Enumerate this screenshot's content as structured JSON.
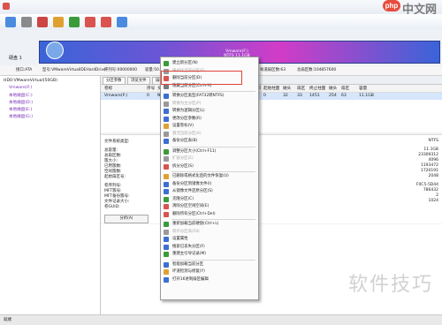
{
  "brand": {
    "logo": "php",
    "text": "中文网"
  },
  "disk": {
    "label": "硬盘 1",
    "partition_name": "Vmware(F:)",
    "partition_size": "NTFS 11.1GB"
  },
  "infobar": {
    "i1": "接口:ATA",
    "i2": "型号:VMwareVirtualIDEHardDrive",
    "i3": "序列号:00000000",
    "i4": "容量:50.0GB(51200MB)",
    "i5": "柱面数:6527",
    "i6": "磁头数:255",
    "i7": "每道扇区数:63",
    "i8": "总扇区数:104857600"
  },
  "tree": {
    "items": [
      {
        "label": "HD0:VMwareVirtual(50GB)",
        "color": "#222222"
      },
      {
        "label": "Vmware(F:)",
        "color": "#7a2fb5"
      },
      {
        "label": "本地磁盘(C:)",
        "color": "#7a2fb5"
      },
      {
        "label": "本地磁盘(D:)",
        "color": "#7a2fb5"
      },
      {
        "label": "本地磁盘(E:)",
        "color": "#7a2fb5"
      },
      {
        "label": "本地磁盘(G:)",
        "color": "#7a2fb5"
      }
    ]
  },
  "tabs": [
    "分区参数",
    "浏览文件",
    "扇区编辑"
  ],
  "filelist": {
    "headers": [
      "卷标",
      "序号",
      "文件系统",
      "标识",
      "起始柱面",
      "磁头",
      "扇区",
      "终止柱面",
      "磁头",
      "扇区",
      "容量"
    ],
    "row": {
      "name": "Vmware(F:)",
      "cells": [
        "0",
        "NTFS",
        "07",
        "0",
        "32",
        "33",
        "1451",
        "254",
        "63",
        "11.1GB"
      ]
    }
  },
  "details": {
    "section_title": "文件系统类型:",
    "labels": [
      "总容量:",
      "总扇区数:",
      "簇大小:",
      "已用簇数:",
      "空闲簇数:",
      "起始扇区号:",
      "卷序列号:",
      "MFT簇号:",
      "MFT备份簇号:",
      "文件记录大小:",
      "卷GUID:"
    ],
    "values": [
      "NTFS",
      "11.1GB",
      "23309312",
      "4096",
      "1193472",
      "1720191",
      "2048",
      "F0C5-5D44",
      "786432",
      "2",
      "1024"
    ],
    "button": "分析(A)"
  },
  "context_menu": {
    "items": [
      {
        "label": "建立新分区(N)",
        "disabled": false,
        "color": "#3a9b3a"
      },
      {
        "label": "格式化当前分区(F)",
        "disabled": true,
        "color": "#999999"
      },
      {
        "label": "删除当前分区(D)",
        "disabled": false,
        "color": "#d9534f"
      },
      {
        "label": "隐藏当前分区(Ctrl+H)",
        "disabled": false,
        "color": "#7a7a7a"
      },
      {
        "label": "转换分区类型(FAT32转NTFS)",
        "disabled": false,
        "color": "#3c6fd1"
      },
      {
        "label": "转换为主分区(P)",
        "disabled": true,
        "color": "#999999"
      },
      {
        "label": "转换为逻辑分区(L)",
        "disabled": false,
        "color": "#3c6fd1"
      },
      {
        "label": "更改分区参数(R)",
        "disabled": false,
        "color": "#3c6fd1"
      },
      {
        "label": "设置卷标(V)",
        "disabled": false,
        "color": "#e0a030"
      },
      {
        "label": "激活当前分区(A)",
        "disabled": true,
        "color": "#999999"
      },
      {
        "label": "备份分区表(B)",
        "disabled": false,
        "color": "#3c6fd1"
      },
      {
        "label": "调整分区大小(Ctrl+F11)",
        "disabled": false,
        "color": "#3a9b3a"
      },
      {
        "label": "扩容分区(E)",
        "disabled": true,
        "color": "#999999"
      },
      {
        "label": "拆分分区(S)",
        "disabled": false,
        "color": "#d9534f"
      },
      {
        "label": "已删除或格式化后的文件恢复(U)",
        "disabled": false,
        "color": "#e0a030"
      },
      {
        "label": "备份分区到镜像文件(I)",
        "disabled": false,
        "color": "#3c6fd1"
      },
      {
        "label": "从镜像文件还原分区(S)",
        "disabled": false,
        "color": "#3c6fd1"
      },
      {
        "label": "克隆分区(C)",
        "disabled": false,
        "color": "#3a9b3a"
      },
      {
        "label": "清除分区空闲空间(E)",
        "disabled": false,
        "color": "#d9534f"
      },
      {
        "label": "删除所有分区(Ctrl+Del)",
        "disabled": false,
        "color": "#d9534f"
      },
      {
        "label": "重新加载当前硬盘(Ctrl+L)",
        "disabled": false,
        "color": "#3a9b3a"
      },
      {
        "label": "保存分区表(F8)",
        "disabled": true,
        "color": "#999999"
      },
      {
        "label": "设置属性",
        "disabled": false,
        "color": "#3c6fd1"
      },
      {
        "label": "搜索已丢失分区(F)",
        "disabled": false,
        "color": "#3c6fd1"
      },
      {
        "label": "重建主引导记录(M)",
        "disabled": false,
        "color": "#3a9b3a"
      },
      {
        "label": "智能加载当前分区",
        "disabled": false,
        "color": "#3c6fd1"
      },
      {
        "label": "坏道检测与修复(Y)",
        "disabled": false,
        "color": "#e0a030"
      },
      {
        "label": "打开16进制扇区编辑",
        "disabled": false,
        "color": "#3c6fd1"
      }
    ]
  },
  "status": "就绪",
  "watermark": "软件技巧"
}
